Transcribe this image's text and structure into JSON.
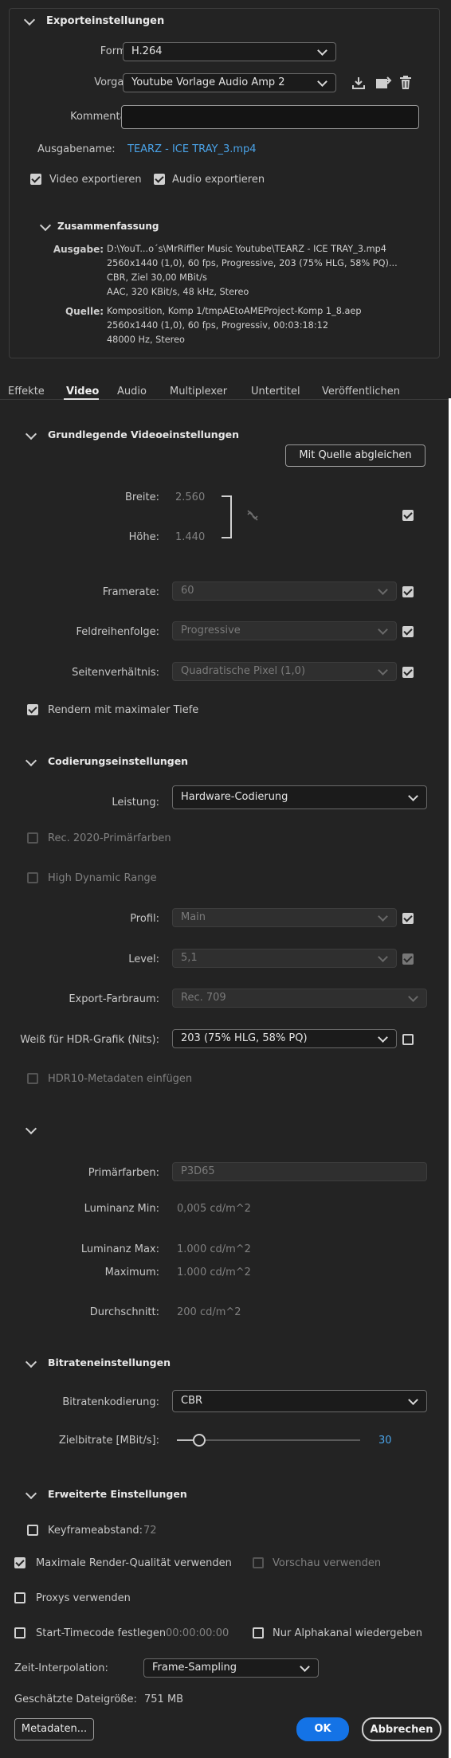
{
  "export_settings": {
    "title": "Exporteinstellungen",
    "format_label": "Format:",
    "format_value": "H.264",
    "preset_label": "Vorgabe:",
    "preset_value": "Youtube Vorlage Audio Amp 2",
    "comments_label": "Kommentare:",
    "comments_value": "",
    "output_name_label": "Ausgabename:",
    "output_name_value": "TEARZ - ICE TRAY_3.mp4",
    "export_video_label": "Video exportieren",
    "export_video_checked": true,
    "export_audio_label": "Audio exportieren",
    "export_audio_checked": true
  },
  "summary": {
    "title": "Zusammenfassung",
    "output_label": "Ausgabe:",
    "output_lines": [
      "D:\\YouT...o´s\\MrRiffler Music Youtube\\TEARZ - ICE TRAY_3.mp4",
      "2560x1440 (1,0), 60 fps, Progressive, 203 (75% HLG, 58% PQ)...",
      "CBR, Ziel 30,00 MBit/s",
      "AAC, 320 KBit/s, 48 kHz, Stereo"
    ],
    "source_label": "Quelle:",
    "source_lines": [
      "Komposition, Komp 1/tmpAEtoAMEProject-Komp 1_8.aep",
      "2560x1440 (1,0), 60 fps, Progressiv, 00:03:18:12",
      "48000 Hz, Stereo"
    ]
  },
  "tabs": [
    "Effekte",
    "Video",
    "Audio",
    "Multiplexer",
    "Untertitel",
    "Veröffentlichen"
  ],
  "active_tab": "Video",
  "basic_video": {
    "title": "Grundlegende Videoeinstellungen",
    "match_source_label": "Mit Quelle abgleichen",
    "width_label": "Breite:",
    "width_value": "2.560",
    "height_label": "Höhe:",
    "height_value": "1.440",
    "framerate_label": "Framerate:",
    "framerate_value": "60",
    "field_order_label": "Feldreihenfolge:",
    "field_order_value": "Progressive",
    "aspect_label": "Seitenverhältnis:",
    "aspect_value": "Quadratische Pixel (1,0)",
    "max_depth_label": "Rendern mit maximaler Tiefe"
  },
  "encoding": {
    "title": "Codierungseinstellungen",
    "performance_label": "Leistung:",
    "performance_value": "Hardware-Codierung",
    "rec2020_label": "Rec. 2020-Primärfarben",
    "hdr_label": "High Dynamic Range",
    "profile_label": "Profil:",
    "profile_value": "Main",
    "level_label": "Level:",
    "level_value": "5,1",
    "color_space_label": "Export-Farbraum:",
    "color_space_value": "Rec. 709",
    "hdr_white_label": "Weiß für HDR-Grafik (Nits):",
    "hdr_white_value": "203 (75% HLG, 58% PQ)",
    "hdr10_label": "HDR10-Metadaten einfügen"
  },
  "hdr_meta": {
    "primaries_label": "Primärfarben:",
    "primaries_value": "P3D65",
    "lum_min_label": "Luminanz Min:",
    "lum_min_value": "0,005 cd/m^2",
    "lum_max_label": "Luminanz Max:",
    "lum_max_value": "1.000 cd/m^2",
    "maximum_label": "Maximum:",
    "maximum_value": "1.000 cd/m^2",
    "average_label": "Durchschnitt:",
    "average_value": "200 cd/m^2"
  },
  "bitrate": {
    "title": "Bitrateneinstellungen",
    "encoding_label": "Bitratenkodierung:",
    "encoding_value": "CBR",
    "target_label": "Zielbitrate [MBit/s]:",
    "target_value": "30",
    "slider_fraction": 0.12
  },
  "advanced": {
    "title": "Erweiterte Einstellungen",
    "keyframe_label": "Keyframeabstand:",
    "keyframe_value": "72"
  },
  "footer": {
    "max_quality_label": "Maximale Render-Qualität verwenden",
    "preview_label": "Vorschau verwenden",
    "proxies_label": "Proxys verwenden",
    "start_tc_label": "Start-Timecode festlegen",
    "start_tc_value": "00:00:00:00",
    "alpha_label": "Nur Alphakanal wiedergeben",
    "interp_label": "Zeit-Interpolation:",
    "interp_value": "Frame-Sampling",
    "filesize_label": "Geschätzte Dateigröße:",
    "filesize_value": "751 MB",
    "metadata_button": "Metadaten...",
    "ok_button": "OK",
    "cancel_button": "Abbrechen"
  },
  "colors": {
    "background": "#232323",
    "accent": "#4aa3e8",
    "ok_button": "#1473e6"
  }
}
